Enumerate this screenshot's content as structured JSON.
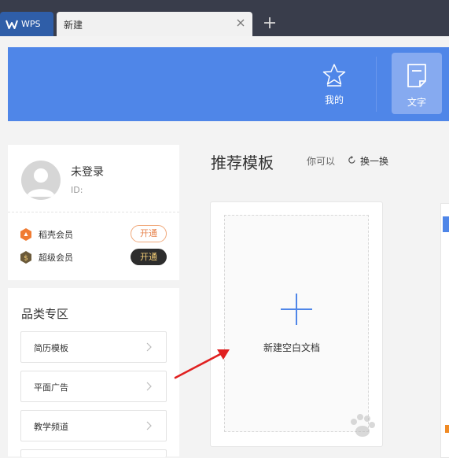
{
  "tabs": {
    "app_label": "WPS",
    "active_label": "新建"
  },
  "header": {
    "mine_label": "我的",
    "doc_label": "文字"
  },
  "profile": {
    "name": "未登录",
    "id_label": "ID:",
    "vip_items": [
      {
        "label": "稻壳会员",
        "button": "开通",
        "icon_color": "#f07b32"
      },
      {
        "label": "超级会员",
        "button": "开通",
        "icon_color": "#6b5a3a"
      }
    ]
  },
  "category": {
    "title": "品类专区",
    "items": [
      {
        "label": "简历模板"
      },
      {
        "label": "平面广告"
      },
      {
        "label": "教学频道"
      }
    ]
  },
  "recommend": {
    "title": "推荐模板",
    "subtitle": "你可以",
    "refresh_label": "换一换",
    "blank_card_label": "新建空白文档"
  },
  "colors": {
    "tabbar": "#393d4b",
    "header_blue": "#4f86e8",
    "arrow_red": "#e02020",
    "plus_blue": "#4f86e8"
  }
}
